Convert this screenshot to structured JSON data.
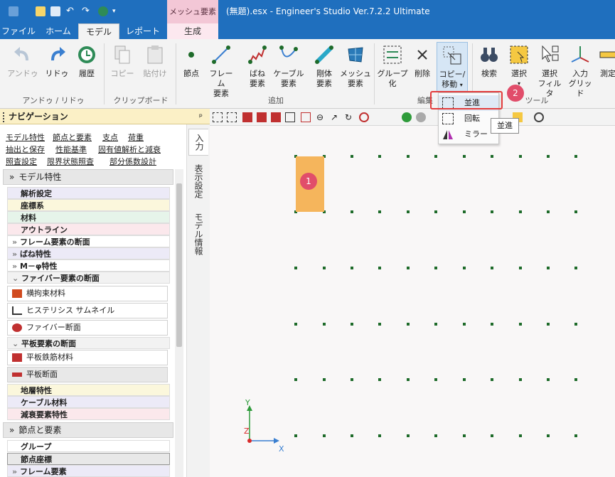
{
  "window": {
    "title": "(無題).esx - Engineer's Studio Ver.7.2.2 Ultimate",
    "contextual_tab": "メッシュ要素"
  },
  "tabs": [
    "ファイル",
    "ホーム",
    "モデル",
    "レポート",
    "生成"
  ],
  "ribbon": {
    "undo": "アンドゥ",
    "redo": "リドゥ",
    "history": "履歴",
    "copy": "コピー",
    "paste": "貼付け",
    "node": "節点",
    "frame": [
      "フレーム",
      "要素"
    ],
    "spring": [
      "ばね",
      "要素"
    ],
    "cable": [
      "ケーブル",
      "要素"
    ],
    "rigid": [
      "剛体",
      "要素"
    ],
    "mesh": [
      "メッシュ",
      "要素"
    ],
    "group": [
      "グループ",
      "化"
    ],
    "delete": "削除",
    "copy_move": [
      "コピー/",
      "移動"
    ],
    "search": "検索",
    "select": "選択",
    "select_filter": [
      "選択",
      "フィルタ"
    ],
    "input_grid": [
      "入力",
      "グリッド"
    ],
    "measure": "測定",
    "groups": {
      "undo_redo": "アンドゥ / リドゥ",
      "clipboard": "クリップボード",
      "add": "追加",
      "edit": "編集",
      "tools": "ツール"
    }
  },
  "dropdown": {
    "translate": "並進",
    "rotate": "回転",
    "mirror": "ミラー"
  },
  "tooltip": "並進",
  "badges": {
    "one": "1",
    "two": "2"
  },
  "nav": {
    "title": "ナビゲーション",
    "pin": "ᵖ",
    "links": [
      [
        "モデル特性",
        "節点と要素",
        "支点",
        "荷重"
      ],
      [
        "抽出と保存",
        "性能基準",
        "固有値解析と減衰"
      ],
      [
        "照査設定",
        "限界状態照査",
        "部分係数設計"
      ]
    ],
    "side_tabs": [
      "入力",
      "表示設定",
      "モデル情報"
    ],
    "section1": "モデル特性",
    "rows1": [
      "解析設定",
      "座標系",
      "材料",
      "アウトライン"
    ],
    "exp_frame": "フレーム要素の断面",
    "exp_spring": "ばね特性",
    "exp_mphi": "M－φ特性",
    "fiber_head": "ファイバー要素の断面",
    "cards1": [
      "横拘束材料",
      "ヒステリシス サムネイル",
      "ファイバー断面"
    ],
    "plate_head": "平板要素の断面",
    "cards2": [
      "平板鉄筋材料",
      "平板断面"
    ],
    "rows2": [
      "地層特性",
      "ケーブル材料",
      "減衰要素特性"
    ],
    "section2": "節点と要素",
    "rows3": [
      "グループ",
      "節点座標",
      "フレーム要素"
    ]
  },
  "axes": {
    "x": "X",
    "y": "Y",
    "z": "Z"
  },
  "colors": {
    "titlebar": "#1f6fbe",
    "contextual": "#f3c7d6",
    "selection": "#f5b55c",
    "highlight": "#e23c3c",
    "badge": "#e14d6a",
    "node": "#1e6b2a"
  }
}
